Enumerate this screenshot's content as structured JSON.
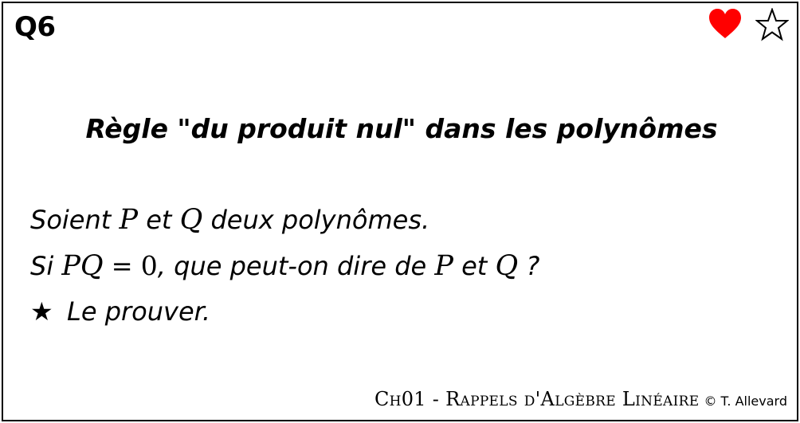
{
  "card": {
    "number": "Q6",
    "icons": {
      "heart": "heart-icon",
      "star": "star-outline-icon",
      "heart_color": "#ff0000"
    },
    "title": "Règle \"du produit nul\" dans les polynômes",
    "line1": {
      "t1": "Soient ",
      "m1": "P",
      "t2": " et ",
      "m2": "Q",
      "t3": " deux polynômes."
    },
    "line2": {
      "t1": "Si ",
      "m1": "PQ",
      "t2": " = ",
      "m2": "0",
      "t3": ", que peut-on dire de ",
      "m3": "P",
      "t4": " et ",
      "m4": "Q",
      "t5": " ?"
    },
    "line3": {
      "star": "★",
      "text": "Le prouver."
    },
    "footer": {
      "chapter": "Ch01 - Rappels d'Algèbre Linéaire",
      "copyright": "© T. Allevard"
    }
  }
}
